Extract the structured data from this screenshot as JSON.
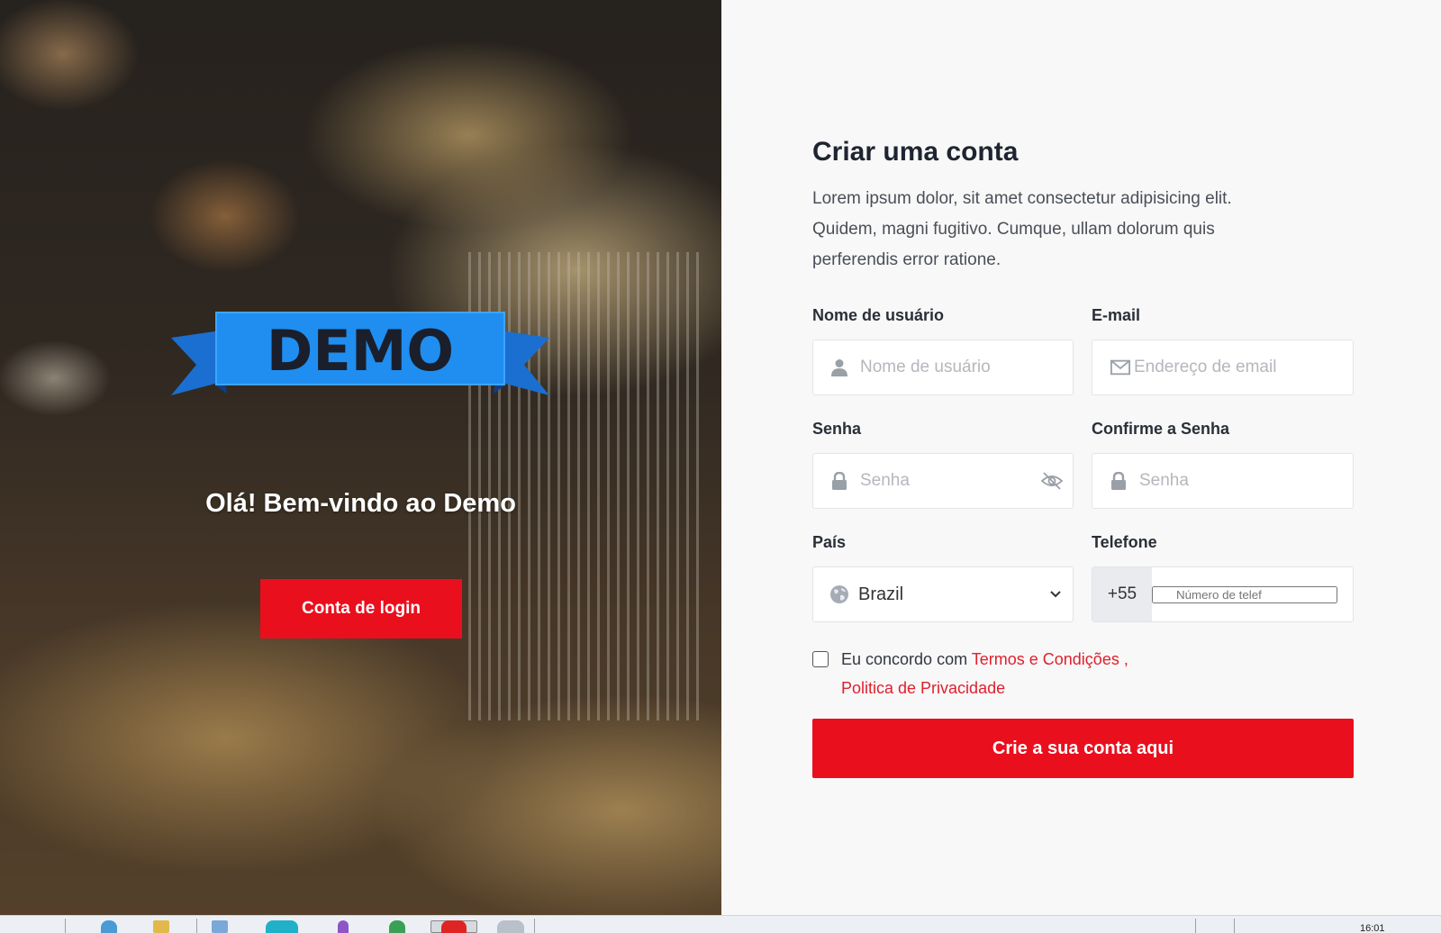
{
  "hero": {
    "logo_text": "DEMO",
    "welcome": "Olá! Bem-vindo ao Demo",
    "login_button": "Conta de login"
  },
  "form": {
    "title": "Criar uma conta",
    "description": "Lorem ipsum dolor, sit amet consectetur adipisicing elit. Quidem, magni fugitivo. Cumque, ullam dolorum quis perferendis error ratione.",
    "username": {
      "label": "Nome de usuário",
      "placeholder": "Nome de usuário",
      "icon": "user-icon"
    },
    "email": {
      "label": "E-mail",
      "placeholder": "Endereço de email",
      "icon": "envelope-icon"
    },
    "password": {
      "label": "Senha",
      "placeholder": "Senha",
      "icon": "lock-icon",
      "toggle_icon": "eye-slash-icon"
    },
    "confirm_password": {
      "label": "Confirme a Senha",
      "placeholder": "Senha",
      "icon": "lock-icon"
    },
    "country": {
      "label": "País",
      "value": "Brazil",
      "icon": "globe-icon"
    },
    "phone": {
      "label": "Telefone",
      "prefix": "+55",
      "placeholder": "Número de telef"
    },
    "agree": {
      "text": "Eu concordo com ",
      "terms": "Termos e Condições ,",
      "privacy": "Politica de Privacidade",
      "checked": false
    },
    "submit": "Crie a sua conta aqui"
  },
  "taskbar": {
    "clock": "16:01"
  },
  "colors": {
    "accent": "#ea0f1d",
    "link": "#e0202e",
    "ribbon": "#1f8ef0"
  }
}
